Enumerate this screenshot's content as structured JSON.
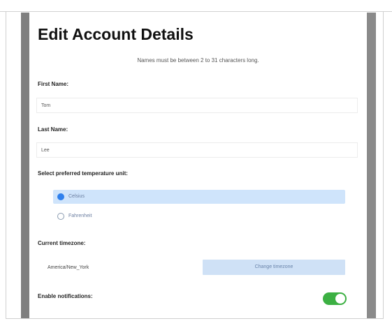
{
  "form": {
    "title": "Edit Account Details",
    "hint": "Names must be between 2 to 31 characters long.",
    "first_name": {
      "label": "First Name:",
      "value": "Tom"
    },
    "last_name": {
      "label": "Last Name:",
      "value": "Lee"
    },
    "temperature": {
      "label": "Select preferred temperature unit:",
      "options": [
        {
          "label": "Celsius",
          "selected": true
        },
        {
          "label": "Fahrenheit",
          "selected": false
        }
      ]
    },
    "timezone": {
      "label": "Current timezone:",
      "value": "America/New_York",
      "button_label": "Change timezone"
    },
    "notifications": {
      "label": "Enable notifications:",
      "enabled": true,
      "color": "#3cb043"
    }
  },
  "colors": {
    "accent": "#2f80ed",
    "selected_row": "#cfe4fb",
    "button_bg": "#cfe1f6",
    "side_bars": "#808080"
  }
}
